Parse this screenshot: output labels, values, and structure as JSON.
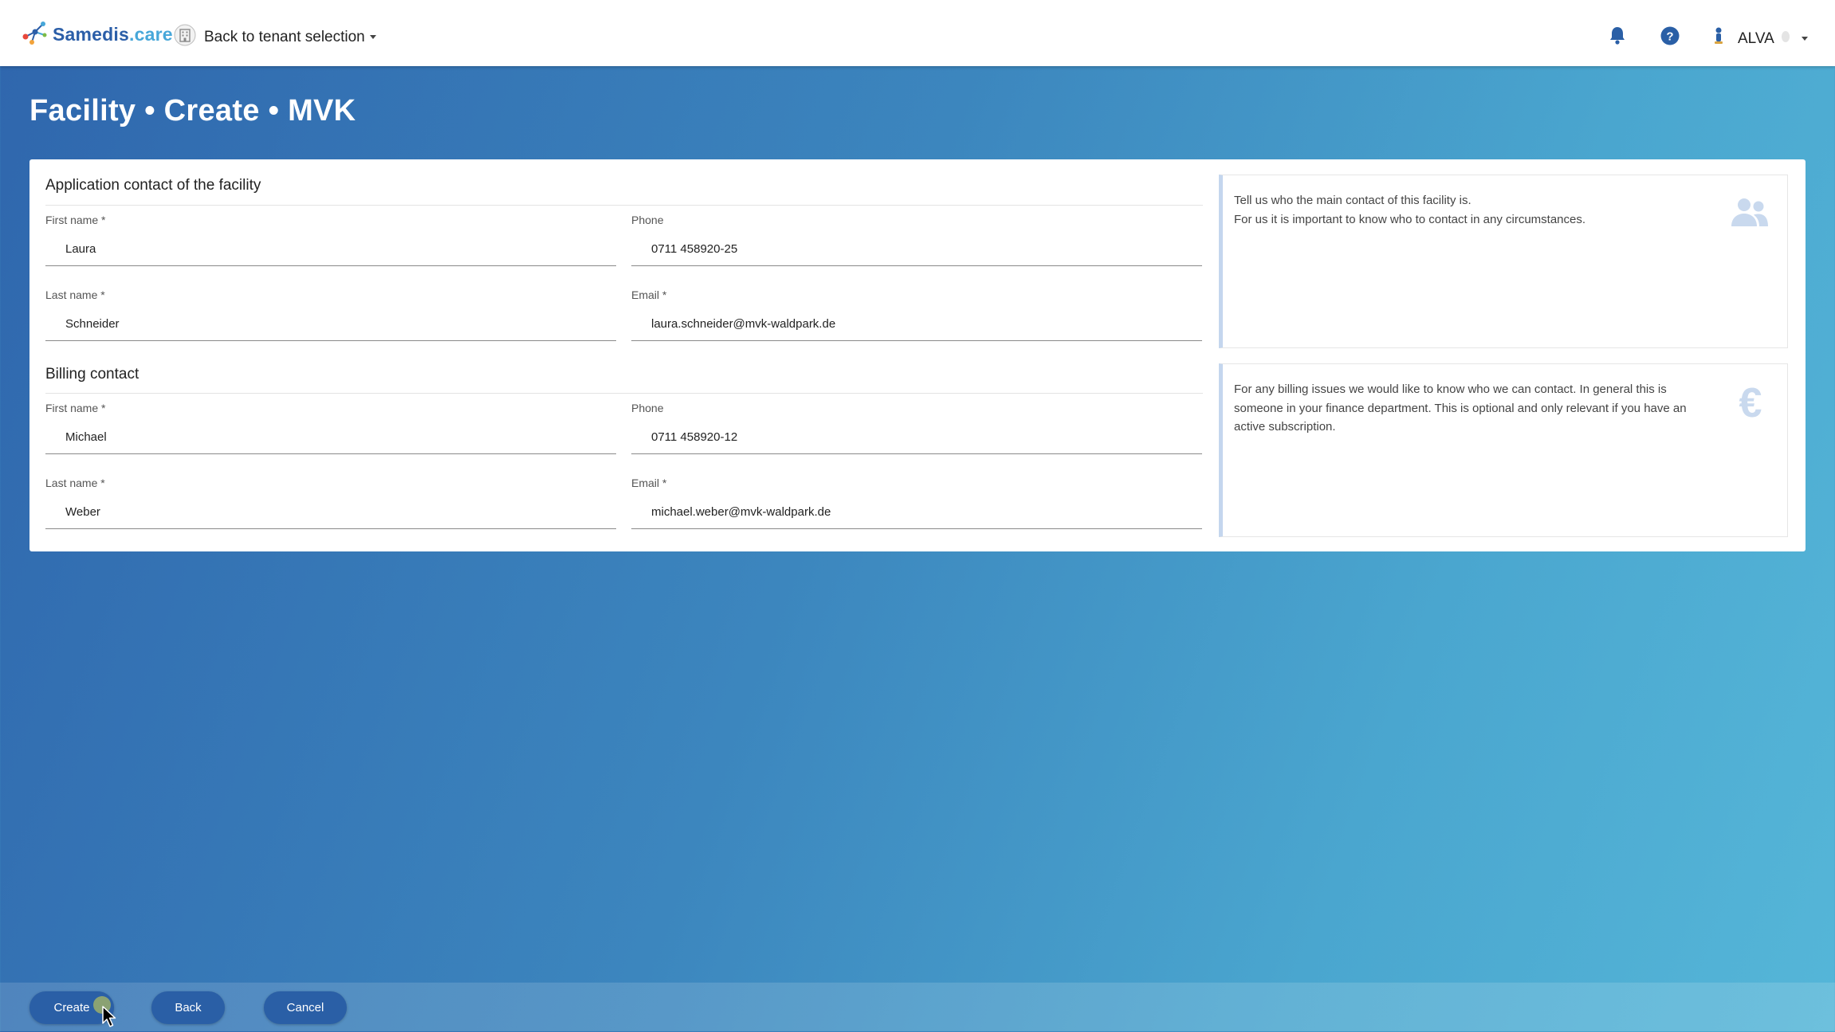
{
  "app": {
    "brand_main": "Samedis",
    "brand_suffix": ".care",
    "tenant_link": "Back to tenant selection",
    "user_name": "ALVA"
  },
  "page": {
    "title": "Facility • Create • MVK"
  },
  "application_contact": {
    "heading": "Application contact of the facility",
    "first_name_label": "First name *",
    "first_name_value": "Laura",
    "phone_label": "Phone",
    "phone_value": "0711 458920-25",
    "last_name_label": "Last name *",
    "last_name_value": "Schneider",
    "email_label": "Email *",
    "email_value": "laura.schneider@mvk-waldpark.de",
    "info_line1": "Tell us who the main contact of this facility is.",
    "info_line2": "For us it is important to know who to contact in any circumstances."
  },
  "billing_contact": {
    "heading": "Billing contact",
    "first_name_label": "First name *",
    "first_name_value": "Michael",
    "phone_label": "Phone",
    "phone_value": "0711 458920-12",
    "last_name_label": "Last name *",
    "last_name_value": "Weber",
    "email_label": "Email *",
    "email_value": "michael.weber@mvk-waldpark.de",
    "info_text": "For any billing issues we would like to know who we can contact. In general this is someone in your finance department. This is optional and only relevant if you have an active subscription."
  },
  "actions": {
    "create_label": "Create",
    "back_label": "Back",
    "cancel_label": "Cancel"
  },
  "icons": {
    "logo": "samedis-logo-icon",
    "tenant": "building-icon",
    "notifications": "bell-icon",
    "help": "help-icon",
    "user": "user-badge-icon",
    "contact_info": "people-icon",
    "billing_info": "euro-icon"
  },
  "colors": {
    "brand_blue": "#2b5ea8",
    "brand_light": "#47a7d9",
    "button": "#2a5fa6",
    "info_accent": "#c4d6ee"
  }
}
